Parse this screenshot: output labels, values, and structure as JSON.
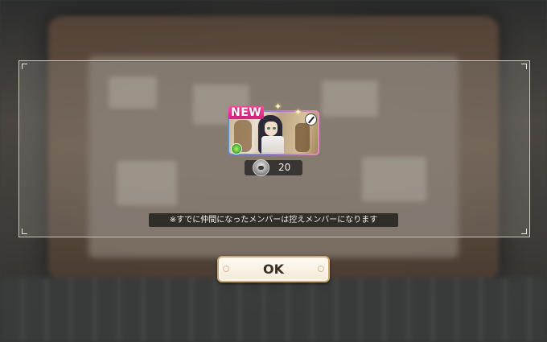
{
  "reward": {
    "badge": "NEW",
    "count": "20",
    "element_icon": "green-element-icon",
    "weapon_icon": "sword-icon",
    "item_icon": "memory-piece-icon"
  },
  "notice": "※すでに仲間になったメンバーは控えメンバーになります",
  "buttons": {
    "ok": "OK"
  },
  "colors": {
    "badge": "#e0287f",
    "card_frame_left": "#5a8ed0",
    "card_frame_right": "#e58cc3",
    "button_border": "#c9a97a",
    "button_text": "#3b2e26"
  }
}
